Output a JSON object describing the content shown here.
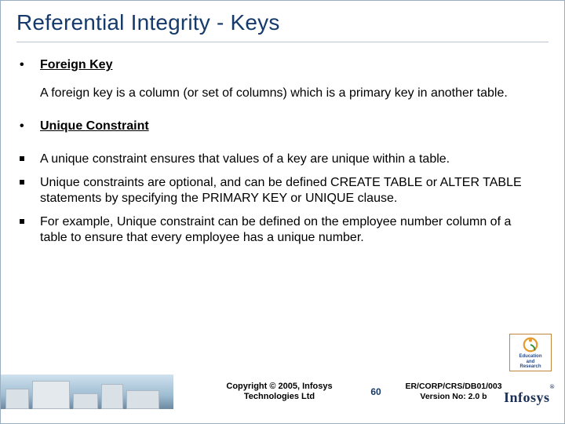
{
  "title": "Referential Integrity - Keys",
  "items": {
    "fk_heading": "Foreign Key",
    "fk_body": "A foreign key is a column (or set of columns) which is a primary key in another table.",
    "uc_heading": "Unique Constraint",
    "uc_b1": "A unique constraint ensures that values of a key are unique within a table.",
    "uc_b2": "Unique constraints are optional, and can be defined CREATE TABLE or ALTER TABLE statements by specifying the PRIMARY KEY or UNIQUE clause.",
    "uc_b3": "For example, Unique constraint can be defined on the employee number column of a table to ensure that every employee has a unique number."
  },
  "footer": {
    "copyright_l1": "Copyright © 2005, Infosys",
    "copyright_l2": "Technologies Ltd",
    "slide_number": "60",
    "docref_l1": "ER/CORP/CRS/DB01/003",
    "docref_l2": "Version No: 2.0 b",
    "company_logo_text": "Infosys",
    "edu_line1": "Education",
    "edu_line2": "and",
    "edu_line3": "Research"
  }
}
